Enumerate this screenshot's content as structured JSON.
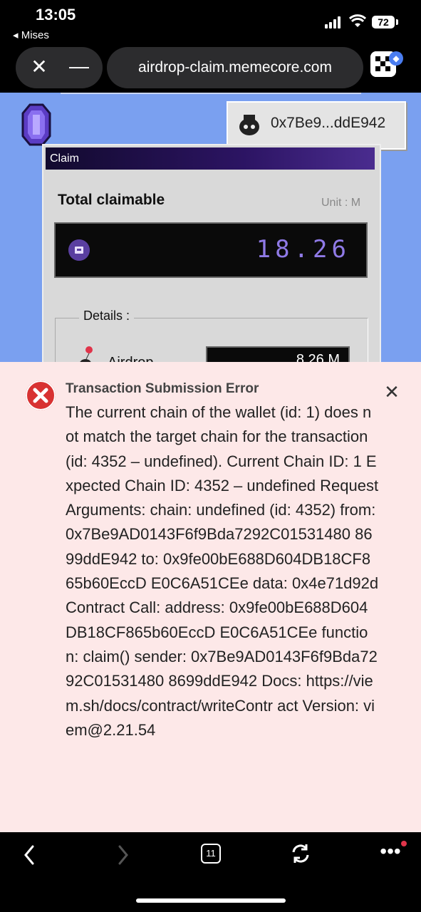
{
  "status_bar": {
    "time": "13:05",
    "back_app": "◂ Mises",
    "battery": "72"
  },
  "browser": {
    "url": "airdrop-claim.memecore.com",
    "tab_count": "11"
  },
  "wallet": {
    "address": "0x7Be9...ddE942"
  },
  "claim": {
    "window_title": "Claim",
    "total_label": "Total claimable",
    "unit_label": "Unit : M",
    "total_value": "18.26",
    "details_label": "Details :",
    "airdrop_label": "Airdrop",
    "airdrop_value": "8.26 M"
  },
  "error": {
    "title": "Transaction Submission Error",
    "message": "The current chain of the wallet (id: 1) does not match the target chain for the transaction (id: 4352 – undefined). Current Chain ID: 1 Expected Chain ID: 4352 – undefined Request Arguments: chain: undefined (id: 4352) from: 0x7Be9AD0143F6f9Bda7292C01531480 8699ddE942 to: 0x9fe00bE688D604DB18CF865b60EccD E0C6A51CEe data: 0x4e71d92d Contract Call: address: 0x9fe00bE688D604DB18CF865b60EccD E0C6A51CEe function: claim() sender: 0x7Be9AD0143F6f9Bda7292C01531480 8699ddE942 Docs: https://viem.sh/docs/contract/writeContr act Version: viem@2.21.54"
  },
  "icons": {
    "status": [
      "signal-icon",
      "wifi-icon",
      "battery-icon"
    ],
    "browser": [
      "close-icon",
      "minimize-icon",
      "extension-icon"
    ],
    "page": [
      "gem-logo-icon",
      "wallet-avatar-icon",
      "meme-token-icon",
      "balloon-icon"
    ],
    "error": [
      "error-icon",
      "close-icon"
    ],
    "bottom": [
      "back-icon",
      "forward-icon",
      "tabs-icon",
      "reload-icon",
      "more-icon"
    ]
  },
  "colors": {
    "page_bg": "#7aa0f0",
    "error_bg": "#fde8e8",
    "error_red": "#d83232",
    "display_purple": "#8f7ae6"
  }
}
